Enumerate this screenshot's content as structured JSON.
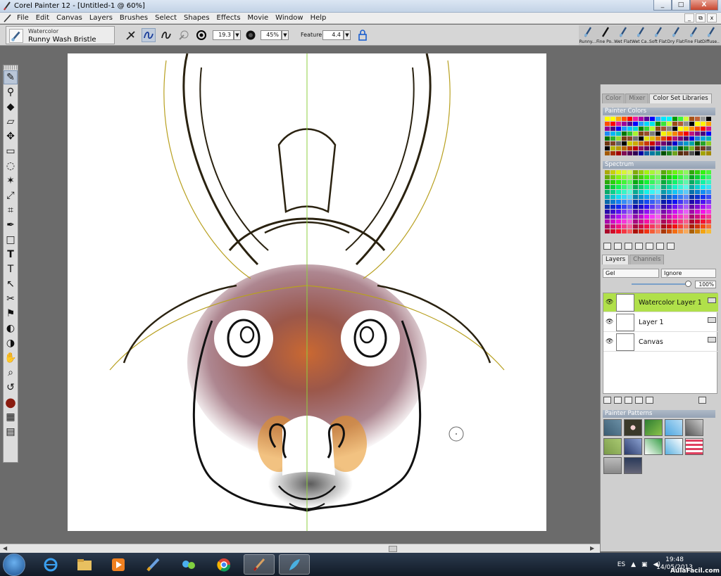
{
  "window": {
    "title": "Corel Painter 12 - [Untitled-1 @ 60%]",
    "minimize": "_",
    "maximize": "□",
    "close": "X"
  },
  "menu": {
    "items": [
      "File",
      "Edit",
      "Canvas",
      "Layers",
      "Brushes",
      "Select",
      "Shapes",
      "Effects",
      "Movie",
      "Window",
      "Help"
    ],
    "doc_min": "_",
    "doc_restore": "⧉",
    "doc_close": "x"
  },
  "property_bar": {
    "brush_category": "Watercolor",
    "brush_variant": "Runny Wash Bristle",
    "size_value": "19.3",
    "opacity_value": "45%",
    "feature_label": "Feature:",
    "feature_value": "4.4",
    "dropdown_glyph": "▼"
  },
  "brush_strip": [
    "Runny...",
    "Fine Po...",
    "Wet Flat",
    "Wet Ca...",
    "Soft Flat",
    "Dry Flat",
    "Fine Flat",
    "Diffuse..."
  ],
  "toolbox": {
    "tools": [
      "brush-icon",
      "dropper-icon",
      "paint-bucket-icon",
      "eraser-icon",
      "layer-adjuster-icon",
      "rect-select-icon",
      "oval-select-icon",
      "magic-wand-icon",
      "transform-icon",
      "crop-icon",
      "pen-icon",
      "rectangle-shape-icon",
      "text-icon",
      "shape-selection-icon",
      "cloner-icon",
      "rubber-stamp-icon",
      "dodge-icon",
      "burn-icon",
      "grabber-icon",
      "magnifier-icon",
      "rotate-page-icon",
      "color-swatch-icon",
      "paper-icon",
      "media-icon"
    ],
    "text_glyph": "T"
  },
  "colors": {
    "main_color": "#8a1c10",
    "additional_color": "#b07a4a",
    "accent": "#b0e04a"
  },
  "color_panel": {
    "tabs": [
      "Color",
      "Mixer",
      "Color Set Libraries"
    ],
    "painter_colors_label": "Painter Colors",
    "spectrum_label": "Spectrum"
  },
  "layers_panel": {
    "tabs": [
      "Layers",
      "Channels"
    ],
    "composite_method": "Gel",
    "preserve": "Ignore",
    "opacity": "100%",
    "layers": [
      {
        "name": "Watercolor Layer 1",
        "selected": true
      },
      {
        "name": "Layer 1",
        "selected": false
      },
      {
        "name": "Canvas",
        "selected": false
      }
    ],
    "eye_glyph": "👁"
  },
  "patterns_panel": {
    "title": "Painter Patterns"
  },
  "taskbar": {
    "language": "ES",
    "time": "19:48",
    "date": "14/05/2013"
  },
  "watermark": "AulaFacil.com"
}
